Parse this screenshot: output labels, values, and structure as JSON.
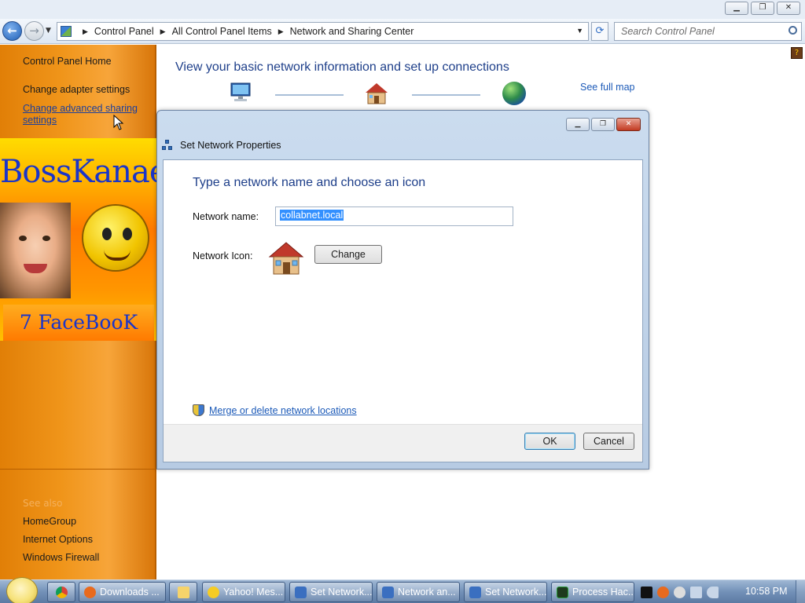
{
  "window": {
    "minimize": "▁",
    "restore": "❐",
    "close": "✕"
  },
  "address_bar": {
    "breadcrumbs": [
      "Control Panel",
      "All Control Panel Items",
      "Network and Sharing Center"
    ],
    "search_placeholder": "Search Control Panel"
  },
  "left_pane": {
    "home": "Control Panel Home",
    "adapter": "Change adapter settings",
    "advanced_line1": "Change advanced sharing",
    "advanced_line2": "settings",
    "see_also": "See also",
    "homegroup": "HomeGroup",
    "internet_options": "Internet Options",
    "firewall": "Windows Firewall"
  },
  "branding": {
    "title": "BossKanae",
    "subtitle": "7 FaceBooK"
  },
  "main": {
    "title": "View your basic network information and set up connections",
    "see_full_map": "See full map"
  },
  "dialog": {
    "title": "Set Network Properties",
    "heading": "Type a network name and choose an icon",
    "network_name_label": "Network name:",
    "network_name_value": "collabnet.local",
    "network_icon_label": "Network Icon:",
    "change_button": "Change",
    "merge_link": "Merge or delete network locations",
    "ok_button": "OK",
    "cancel_button": "Cancel"
  },
  "taskbar": {
    "items": [
      {
        "label": "Downloads ...",
        "icon_color": "#e86a1e"
      },
      {
        "label": "Yahoo! Mes...",
        "icon_color": "#f5cc24"
      },
      {
        "label": "Set Network...",
        "icon_color": "#3a6fc0"
      },
      {
        "label": "Network an...",
        "icon_color": "#3a6fc0"
      },
      {
        "label": "Set Network...",
        "icon_color": "#3a6fc0"
      },
      {
        "label": "Process Hac...",
        "icon_color": "#2a9c3a"
      }
    ],
    "clock": "10:58 PM"
  },
  "colors": {
    "accent_blue": "#1e3f8a",
    "link_blue": "#1c5ab8",
    "sidebar_orange": "#f0951a",
    "brand_blue": "#1a35c9"
  }
}
